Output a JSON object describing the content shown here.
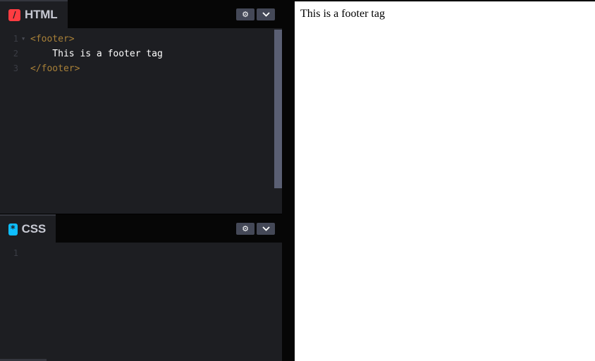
{
  "html_panel": {
    "tab_label": "HTML",
    "icon": "codepen-html-icon",
    "lines": [
      {
        "num": "1",
        "text": "<footer>",
        "kind": "tag"
      },
      {
        "num": "2",
        "text": "    This is a footer tag",
        "kind": "text"
      },
      {
        "num": "3",
        "text": "</footer>",
        "kind": "tag"
      }
    ]
  },
  "css_panel": {
    "tab_label": "CSS",
    "icon": "codepen-css-icon",
    "lines": [
      {
        "num": "1",
        "text": ""
      }
    ]
  },
  "buttons": {
    "settings_icon": "gear-icon",
    "collapse_icon": "chevron-down-icon"
  },
  "preview": {
    "content": "This is a footer tag"
  },
  "colors": {
    "html_accent": "#ff3c41",
    "css_accent": "#0ebeff",
    "tag_color": "#a88038",
    "editor_bg": "#1d1e22"
  }
}
